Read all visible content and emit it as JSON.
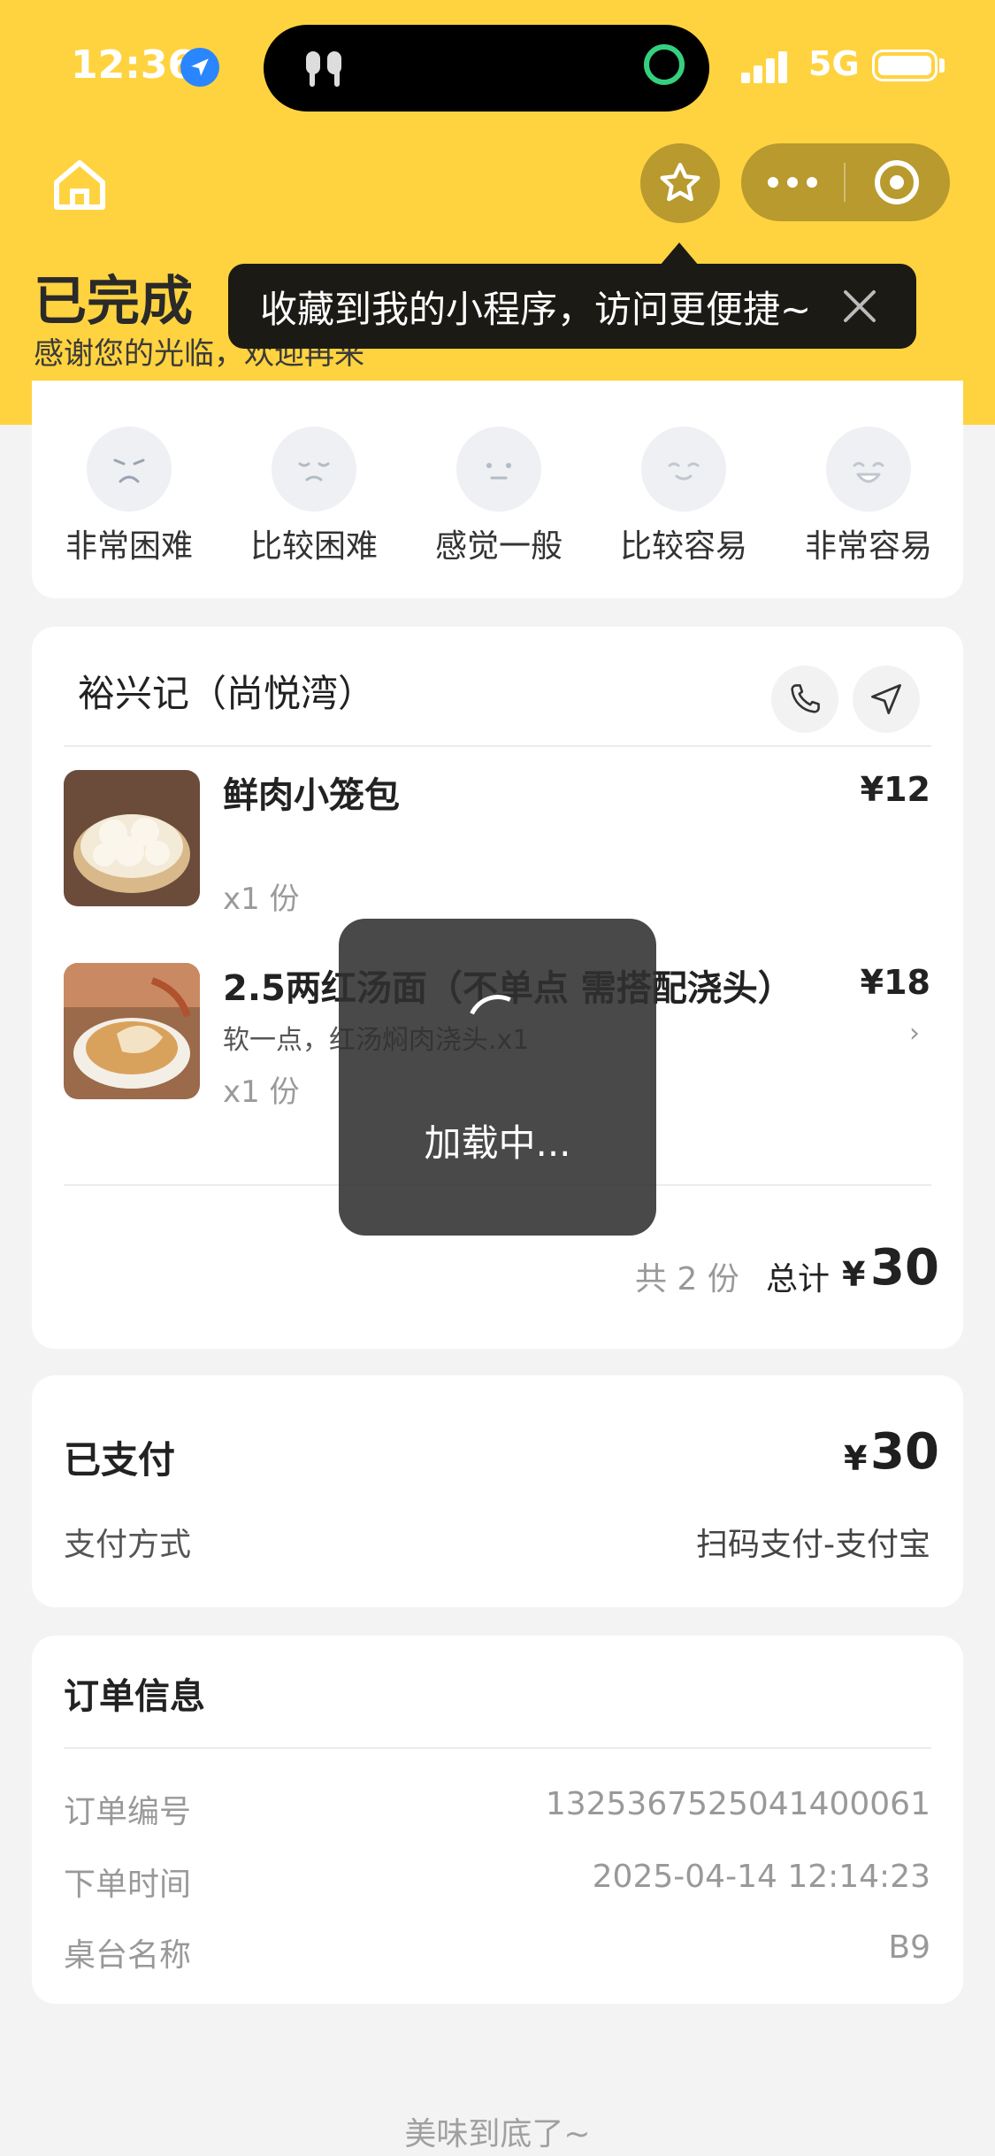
{
  "status_bar": {
    "time": "12:36",
    "network": "5G"
  },
  "header": {
    "status_title": "已完成",
    "status_subtitle": "感谢您的光临，欢迎再来",
    "bg_color": "#FFD33F"
  },
  "tooltip": {
    "text": "收藏到我的小程序，访问更便捷~"
  },
  "rating": {
    "options": [
      {
        "label": "非常困难",
        "icon": "very-hard-face-icon"
      },
      {
        "label": "比较困难",
        "icon": "hard-face-icon"
      },
      {
        "label": "感觉一般",
        "icon": "neutral-face-icon"
      },
      {
        "label": "比较容易",
        "icon": "easy-face-icon"
      },
      {
        "label": "非常容易",
        "icon": "very-easy-face-icon"
      }
    ]
  },
  "order": {
    "shop_name": "裕兴记（尚悦湾）",
    "items": [
      {
        "name": "鲜肉小笼包",
        "price": "¥12",
        "qty": "x1 份",
        "note": ""
      },
      {
        "name": "2.5两红汤面（不单点 需搭配浇头）",
        "price": "¥18",
        "qty": "x1 份",
        "note": "软一点，红汤焖肉浇头.x1"
      }
    ],
    "count_text": "共 2 份",
    "total_label": "总计",
    "currency": "¥",
    "total": "30"
  },
  "payment": {
    "title": "已支付",
    "currency": "¥",
    "amount": "30",
    "method_label": "支付方式",
    "method_value": "扫码支付-支付宝"
  },
  "order_info": {
    "title": "订单信息",
    "rows": [
      {
        "label": "订单编号",
        "value": "1325367525041400061"
      },
      {
        "label": "下单时间",
        "value": "2025-04-14 12:14:23"
      },
      {
        "label": "桌台名称",
        "value": "B9"
      }
    ]
  },
  "footer": {
    "text": "美味到底了~"
  },
  "loading": {
    "text": "加载中..."
  }
}
